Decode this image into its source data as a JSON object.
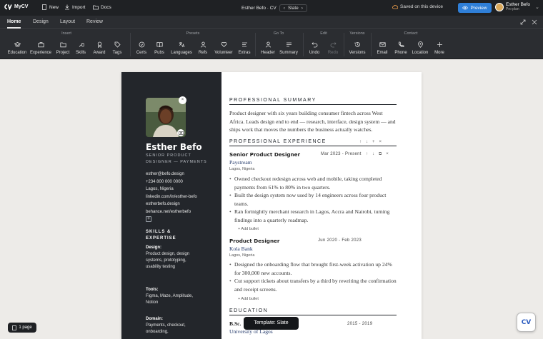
{
  "app": {
    "name": "MyCV"
  },
  "titlebar": {
    "new_label": "New",
    "import_label": "Import",
    "docs_label": "Docs",
    "doc_title": "Esther Befo · CV",
    "template_name": "Slate",
    "saved_text": "Saved on this device",
    "preview_label": "Preview",
    "user_name": "Esther Befo",
    "user_plan": "Pro plan"
  },
  "tabs": [
    "Home",
    "Design",
    "Layout",
    "Review"
  ],
  "ribbon": {
    "groups": [
      "Insert",
      "Presets",
      "Go To",
      "Edit",
      "Versions",
      "Contact"
    ],
    "insert": [
      "Education",
      "Experience",
      "Project",
      "Skills",
      "Award",
      "Tags"
    ],
    "presets": [
      "Certs",
      "Pubs",
      "Languages",
      "Refs",
      "Volunteer",
      "Extras"
    ],
    "goto": [
      "Header",
      "Summary"
    ],
    "edit": [
      "Undo",
      "Redo"
    ],
    "versions": [
      "Versions"
    ],
    "contact": [
      "Email",
      "Phone",
      "Location",
      "More"
    ]
  },
  "resume": {
    "name": "Esther Befo",
    "role": "Senior Product Designer — Payments",
    "contacts": [
      "esther@befo.design",
      "+234 800 000 0000",
      "Lagos, Nigeria",
      "linkedin.com/in/esther-befo",
      "estherbefo.design",
      "behance.net/estherbefo"
    ],
    "skills_heading": "Skills & Expertise",
    "skills": [
      {
        "label": "Design:",
        "text": "Product design, design systems, prototyping, usability testing"
      },
      {
        "label": "Tools:",
        "text": "Figma, Maze, Amplitude, Notion"
      },
      {
        "label": "Domain:",
        "text": "Payments, checkout, onboarding,"
      }
    ],
    "summary_heading": "Professional Summary",
    "summary": "Product designer with six years building consumer fintech across West Africa. Leads design end to end — research, interface, design system — and ships work that moves the numbers the business actually watches.",
    "experience_heading": "Professional Experience",
    "jobs": [
      {
        "title": "Senior Product Designer",
        "date": "Mar 2023 - Present",
        "company": "Paystream",
        "location": "Lagos, Nigeria",
        "bullets": [
          "Owned checkout redesign across web and mobile, taking completed payments from 61% to 80% in two quarters.",
          "Built the design system now used by 14 engineers across four product teams.",
          "Ran fortnightly merchant research in Lagos, Accra and Nairobi, turning findings into a quarterly roadmap."
        ]
      },
      {
        "title": "Product Designer",
        "date": "Jun 2020 - Feb 2023",
        "company": "Kola Bank",
        "location": "Lagos, Nigeria",
        "bullets": [
          "Designed the onboarding flow that brought first-week activation up 24% for 300,000 new accounts.",
          "Cut support tickets about transfers by a third by rewriting the confirmation and receipt screens."
        ]
      }
    ],
    "add_bullet_label": "+ Add bullet",
    "education_heading": "Education",
    "education": {
      "degree": "B.Sc.",
      "date": "2015 - 2019",
      "school": "University of Lagos"
    }
  },
  "toast": "Template: Slate",
  "page_count": "1 page",
  "badge": "CV",
  "colors": {
    "accent": "#2f7fd8",
    "sidebar": "#23262b",
    "chrome": "#2b2d31"
  }
}
